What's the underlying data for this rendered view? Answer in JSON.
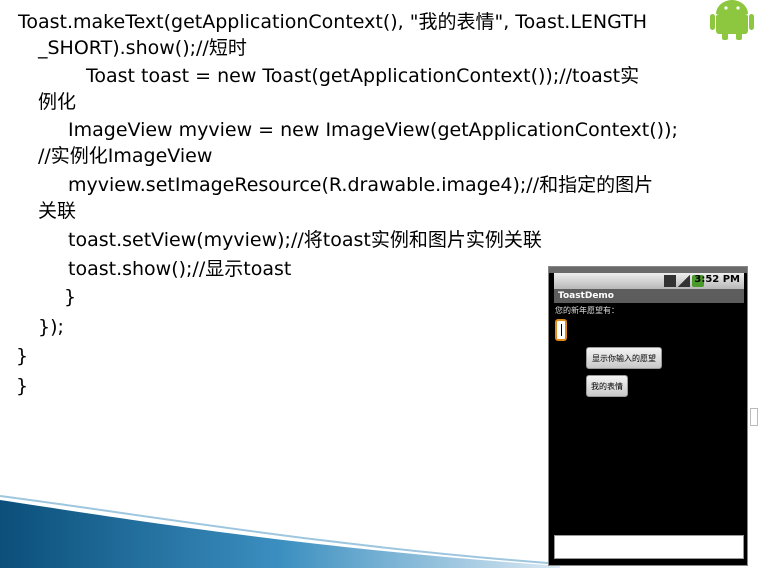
{
  "slide": {
    "code_lines": [
      "Toast.makeText(getApplicationContext(), \"我的表情\", Toast.LENGTH",
      "_SHORT).show();//短时",
      "Toast toast = new Toast(getApplicationContext());//toast实",
      "例化",
      "ImageView myview = new ImageView(getApplicationContext());",
      "//实例化ImageView",
      "myview.setImageResource(R.drawable.image4);//和指定的图片",
      "关联",
      "toast.setView(myview);//将toast实例和图片实例关联",
      "toast.show();//显示toast",
      "}",
      "});",
      "}",
      "}"
    ],
    "logo_icon": "android-robot-icon"
  },
  "phone": {
    "status_time": "3:52 PM",
    "app_title": "ToastDemo",
    "prompt_text": "您的新年愿望有：",
    "button_show_wish": "显示你输入的愿望",
    "button_my_emoji": "我的表情",
    "accent_color": "#e08a1c"
  }
}
